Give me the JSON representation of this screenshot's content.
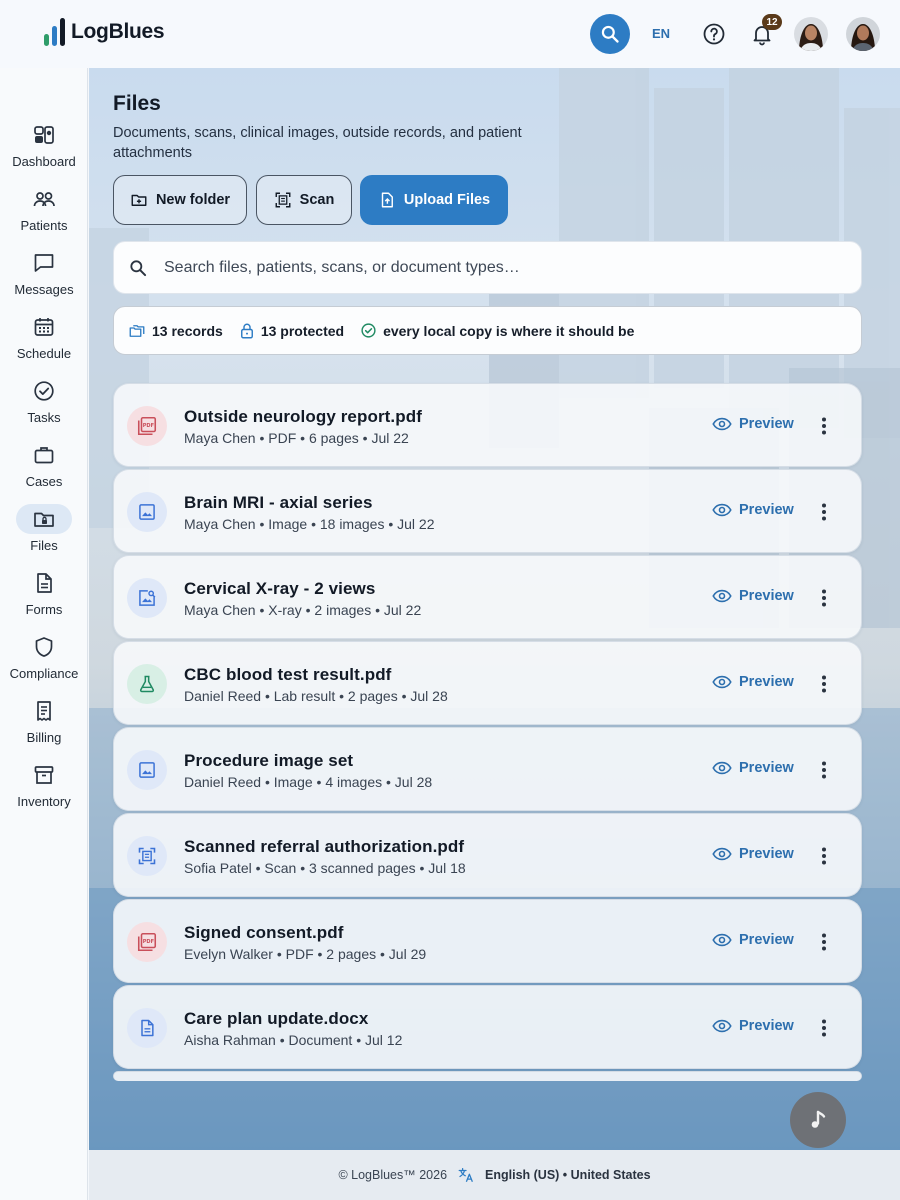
{
  "app": {
    "name": "LogBlues"
  },
  "topbar": {
    "language": "EN",
    "notification_count": "12"
  },
  "sidebar": {
    "items": [
      {
        "label": "Dashboard",
        "icon": "dashboard-icon"
      },
      {
        "label": "Patients",
        "icon": "patients-icon"
      },
      {
        "label": "Messages",
        "icon": "messages-icon"
      },
      {
        "label": "Schedule",
        "icon": "calendar-icon"
      },
      {
        "label": "Tasks",
        "icon": "check-circle-icon"
      },
      {
        "label": "Cases",
        "icon": "briefcase-icon"
      },
      {
        "label": "Files",
        "icon": "folder-lock-icon",
        "active": true
      },
      {
        "label": "Forms",
        "icon": "document-icon"
      },
      {
        "label": "Compliance",
        "icon": "shield-icon"
      },
      {
        "label": "Billing",
        "icon": "receipt-icon"
      },
      {
        "label": "Inventory",
        "icon": "archive-icon"
      }
    ]
  },
  "page": {
    "title": "Files",
    "subtitle": "Documents, scans, clinical images, outside records, and patient attachments"
  },
  "actions": {
    "new_folder": "New folder",
    "scan": "Scan",
    "upload": "Upload Files"
  },
  "search": {
    "placeholder": "Search files, patients, scans, or document types…"
  },
  "stats": {
    "records": "13 records",
    "protected": "13 protected",
    "status": "every local copy is where it should be"
  },
  "files": [
    {
      "name": "Outside neurology report.pdf",
      "meta": "Maya Chen • PDF • 6 pages • Jul 22",
      "icon": "pdf-icon"
    },
    {
      "name": "Brain MRI - axial series",
      "meta": "Maya Chen • Image • 18 images • Jul 22",
      "icon": "image-icon"
    },
    {
      "name": "Cervical X-ray - 2 views",
      "meta": "Maya Chen • X-ray • 2 images • Jul 22",
      "icon": "image-search-icon"
    },
    {
      "name": "CBC blood test result.pdf",
      "meta": "Daniel Reed • Lab result • 2 pages • Jul 28",
      "icon": "flask-icon"
    },
    {
      "name": "Procedure image set",
      "meta": "Daniel Reed • Image • 4 images • Jul 28",
      "icon": "image-icon"
    },
    {
      "name": "Scanned referral authorization.pdf",
      "meta": "Sofia Patel • Scan • 3 scanned pages • Jul 18",
      "icon": "scan-document-icon"
    },
    {
      "name": "Signed consent.pdf",
      "meta": "Evelyn Walker • PDF • 2 pages • Jul 29",
      "icon": "pdf-icon"
    },
    {
      "name": "Care plan update.docx",
      "meta": "Aisha Rahman • Document • Jul 12",
      "icon": "document-icon"
    }
  ],
  "preview_label": "Preview",
  "footer": {
    "copyright": "© LogBlues™ 2026",
    "locale": "English (US) • United States"
  },
  "colors": {
    "primary": "#2d7cc4",
    "pdf": "#c94f5a",
    "image": "#3c73d6",
    "lab": "#1f8a62"
  }
}
